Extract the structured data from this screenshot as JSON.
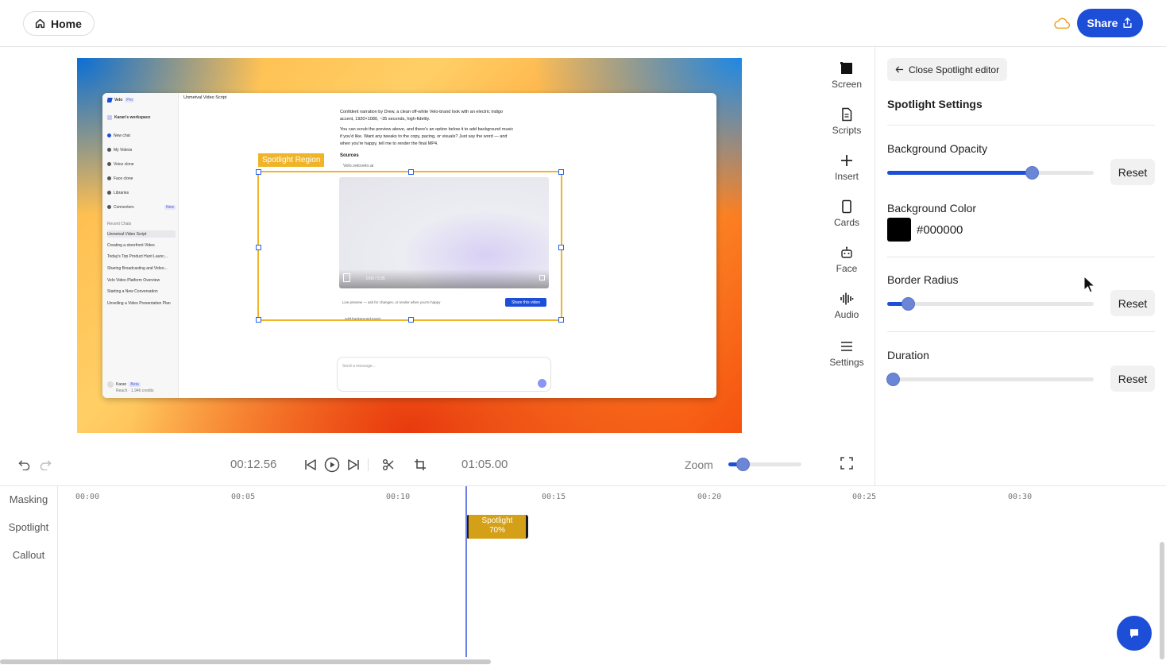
{
  "header": {
    "home_label": "Home",
    "share_label": "Share"
  },
  "preview": {
    "spotlight_label": "Spotlight Region",
    "app": {
      "brand": "Velo",
      "brand_badge": "Pro",
      "workspace": "Karan's workspace",
      "nav": [
        "New chat",
        "My Videos",
        "Voice clone",
        "Face clone",
        "Libraries",
        "Connectors"
      ],
      "connectors_badge": "New",
      "recent_title": "Recent Chats",
      "recent": [
        "Unmetval Video Script",
        "Creating a storefront Video",
        "Today's Top Product Hunt Launc...",
        "Sharing Broadcasting and Video...",
        "Velo Video Platform Overview",
        "Starting a New Conversation",
        "Unveiling a Video Presentation Plan"
      ],
      "user_name": "Karan",
      "user_badge": "Beta",
      "user_credits": "Reach · 1,946 credits",
      "chat_title": "Unmetval Video Script",
      "para1": [
        "Confident narration by Drew, a clean off-white Velo-brand look with an electric indigo",
        "accent, 1920×1080, ~35 seconds, high-fidelity."
      ],
      "para2": [
        "You can scrub the preview above, and there's an option below it to add background music",
        "if you'd like. Want any tweaks to the copy, pacing, or visuals? Just say the word — and",
        "when you're happy, tell me to render the final MP4."
      ],
      "sources_title": "Sources",
      "source_item": "Velo.velovelo.ai",
      "video_time": "0:00 / 0:35",
      "preview_note": "Live preview — ask for changes, or render when you're happy",
      "share_video_label": "Share this video",
      "add_music_label": "Add background music",
      "message_placeholder": "Send a message..."
    }
  },
  "tools": [
    {
      "label": "Screen",
      "icon": "screen-icon"
    },
    {
      "label": "Scripts",
      "icon": "file-icon"
    },
    {
      "label": "Insert",
      "icon": "plus-icon"
    },
    {
      "label": "Cards",
      "icon": "card-icon"
    },
    {
      "label": "Face",
      "icon": "robot-icon"
    },
    {
      "label": "Audio",
      "icon": "waveform-icon"
    },
    {
      "label": "Settings",
      "icon": "menu-icon"
    }
  ],
  "panel": {
    "close_label": "Close Spotlight editor",
    "title": "Spotlight Settings",
    "opacity_label": "Background Opacity",
    "opacity_value": 0.7,
    "color_label": "Background Color",
    "color_value": "#000000",
    "radius_label": "Border Radius",
    "radius_value": 0.1,
    "duration_label": "Duration",
    "duration_value": 0.0,
    "reset_label": "Reset"
  },
  "transport": {
    "current_time": "00:12.56",
    "total_time": "01:05.00",
    "zoom_label": "Zoom",
    "zoom_value": 0.2
  },
  "timeline": {
    "tracks": [
      "Masking",
      "Spotlight",
      "Callout"
    ],
    "ticks": [
      "00:00",
      "00:05",
      "00:10",
      "00:15",
      "00:20",
      "00:25",
      "00:30"
    ],
    "clip_title": "Spotlight",
    "clip_value": "70%"
  },
  "colors": {
    "accent": "#1d4ed8",
    "spotlight": "#f0b429",
    "clip": "#d4a017"
  }
}
